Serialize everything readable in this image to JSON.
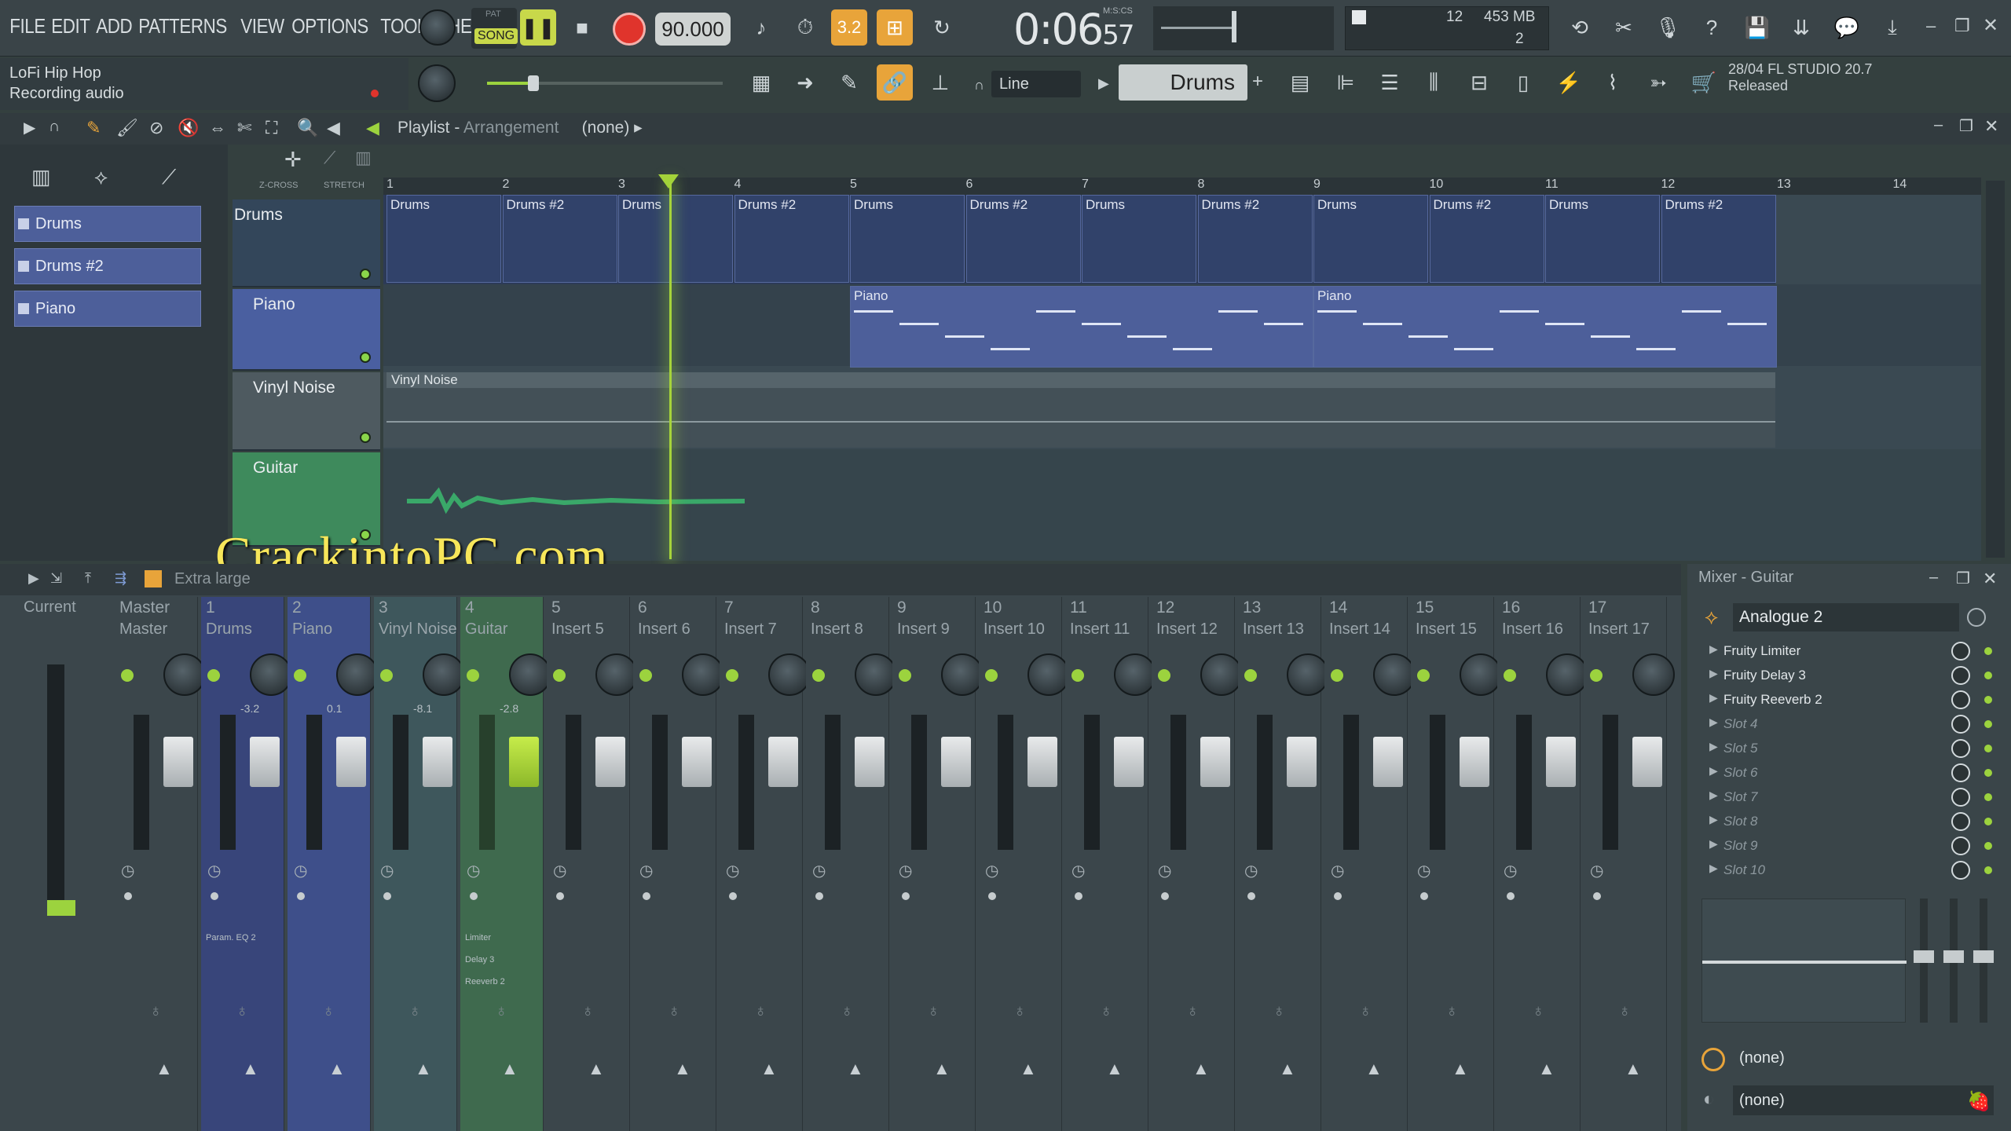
{
  "menu": [
    "FILE",
    "EDIT",
    "ADD",
    "PATTERNS",
    "VIEW",
    "OPTIONS",
    "TOOLS",
    "HELP"
  ],
  "hint": {
    "title": "LoFi Hip Hop",
    "status": "Recording audio"
  },
  "transport": {
    "mode_top": "PAT",
    "mode": "SONG",
    "tempo": "90.000",
    "time_main": "0:06",
    "time_sub": "57",
    "time_unit": "M:S:CS",
    "snap": "3.2"
  },
  "cpu": {
    "value": "12",
    "mem": "453 MB",
    "poly": "2"
  },
  "toolbar2": {
    "snap_label": "Line",
    "pattern": "Drums",
    "news_date": "28/04",
    "news_title": "FL STUDIO 20.7",
    "news_status": "Released"
  },
  "playlist": {
    "title": "Playlist",
    "sub": "Arrangement",
    "selection": "(none)",
    "zcross": "Z-CROSS",
    "stretch": "STRETCH"
  },
  "patterns": [
    "Drums",
    "Drums #2",
    "Piano"
  ],
  "tracks": [
    "Drums",
    "Piano",
    "Vinyl Noise",
    "Guitar"
  ],
  "ruler": [
    "1",
    "2",
    "3",
    "4",
    "5",
    "6",
    "7",
    "8",
    "9",
    "10",
    "11",
    "12",
    "13",
    "14"
  ],
  "clips": {
    "drums": [
      "Drums",
      "Drums #2",
      "Drums",
      "Drums #2",
      "Drums",
      "Drums #2",
      "Drums",
      "Drums #2",
      "Drums",
      "Drums #2",
      "Drums",
      "Drums #2"
    ],
    "piano": [
      "Piano",
      "Piano"
    ],
    "vinyl": "Vinyl Noise"
  },
  "watermark": "CrackintoPC.com",
  "mixer": {
    "bar_label": "Extra large",
    "current": "Current",
    "strips": [
      {
        "num": "Master",
        "name": "Master",
        "db": ""
      },
      {
        "num": "1",
        "name": "Drums",
        "db": "-3.2"
      },
      {
        "num": "2",
        "name": "Piano",
        "db": "0.1"
      },
      {
        "num": "3",
        "name": "Vinyl Noise",
        "db": "-8.1"
      },
      {
        "num": "4",
        "name": "Guitar",
        "db": "-2.8"
      },
      {
        "num": "5",
        "name": "Insert 5",
        "db": ""
      },
      {
        "num": "6",
        "name": "Insert 6",
        "db": ""
      },
      {
        "num": "7",
        "name": "Insert 7",
        "db": ""
      },
      {
        "num": "8",
        "name": "Insert 8",
        "db": ""
      },
      {
        "num": "9",
        "name": "Insert 9",
        "db": ""
      },
      {
        "num": "10",
        "name": "Insert 10",
        "db": ""
      },
      {
        "num": "11",
        "name": "Insert 11",
        "db": ""
      },
      {
        "num": "12",
        "name": "Insert 12",
        "db": ""
      },
      {
        "num": "13",
        "name": "Insert 13",
        "db": ""
      },
      {
        "num": "14",
        "name": "Insert 14",
        "db": ""
      },
      {
        "num": "15",
        "name": "Insert 15",
        "db": ""
      },
      {
        "num": "16",
        "name": "Insert 16",
        "db": ""
      },
      {
        "num": "17",
        "name": "Insert 17",
        "db": ""
      }
    ],
    "fx_drums": "Param. EQ 2",
    "fx_guitar": [
      "Limiter",
      "Delay 3",
      "Reeverb 2"
    ]
  },
  "mixer_panel": {
    "title": "Mixer - Guitar",
    "preset": "Analogue 2",
    "slots": [
      "Fruity Limiter",
      "Fruity Delay 3",
      "Fruity Reeverb 2",
      "Slot 4",
      "Slot 5",
      "Slot 6",
      "Slot 7",
      "Slot 8",
      "Slot 9",
      "Slot 10"
    ],
    "input": "(none)",
    "output": "(none)"
  },
  "colors": {
    "accent": "#e8a43a",
    "record": "#e0342c",
    "led": "#9cd33e",
    "pattern": "#4d5f9a",
    "playhead": "#a6d43a",
    "guitar": "#3e8a5c"
  }
}
